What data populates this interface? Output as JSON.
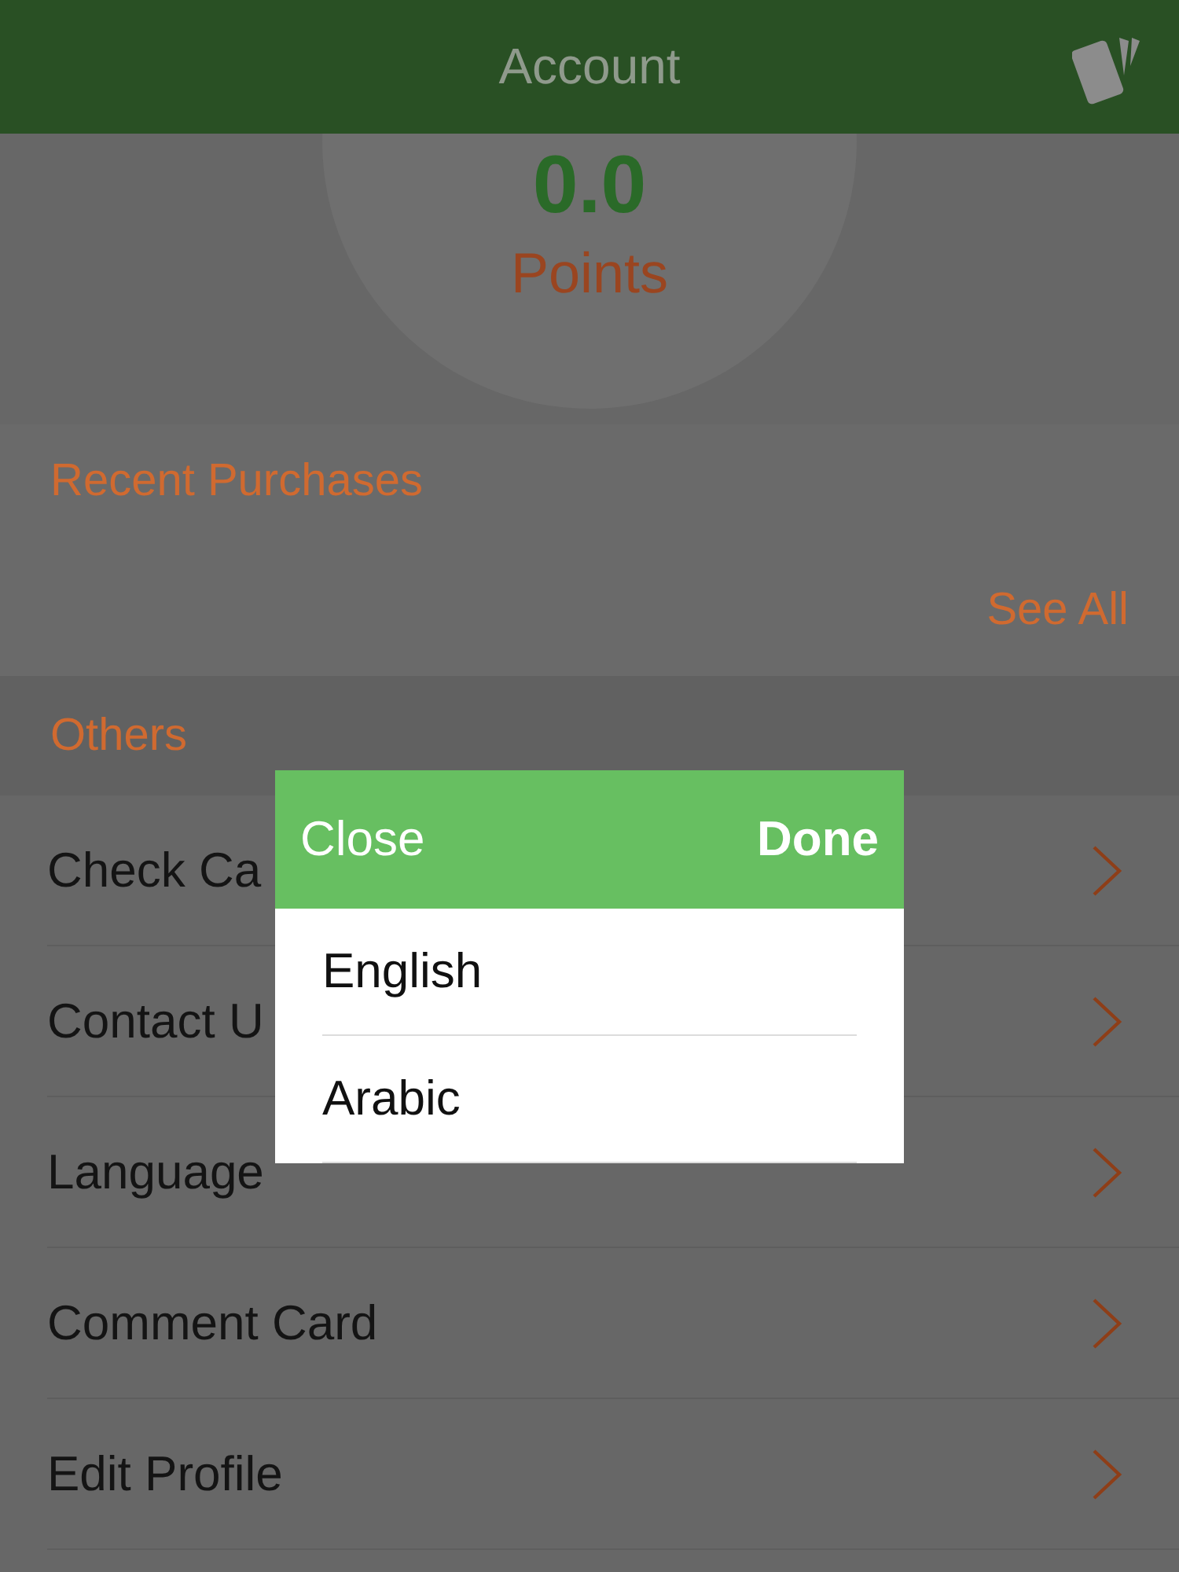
{
  "header": {
    "title": "Account"
  },
  "points": {
    "value": "0.0",
    "label": "Points"
  },
  "recent_purchases": {
    "title": "Recent Purchases",
    "see_all": "See All"
  },
  "others": {
    "title": "Others",
    "items": [
      {
        "label": "Check Ca"
      },
      {
        "label": "Contact U"
      },
      {
        "label": "Language"
      },
      {
        "label": "Comment Card"
      },
      {
        "label": "Edit Profile"
      }
    ]
  },
  "picker": {
    "close": "Close",
    "done": "Done",
    "options": [
      {
        "label": "English"
      },
      {
        "label": "Arabic"
      }
    ]
  }
}
